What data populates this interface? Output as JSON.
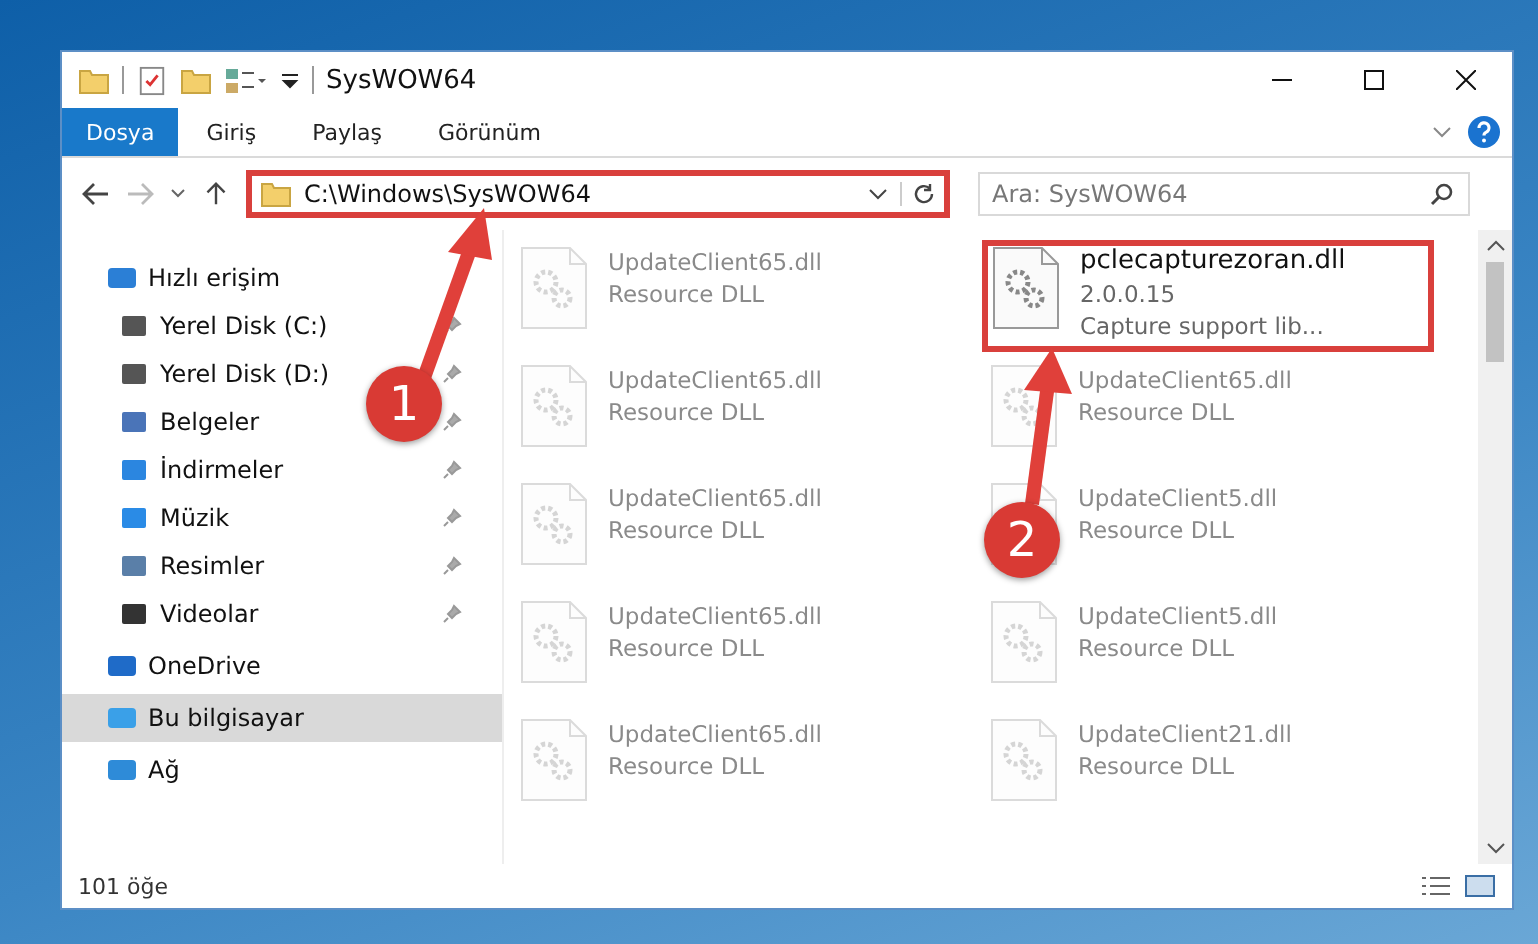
{
  "window": {
    "title": "SysWOW64"
  },
  "ribbon_tabs": [
    {
      "label": "Dosya",
      "selected": true
    },
    {
      "label": "Giriş",
      "selected": false
    },
    {
      "label": "Paylaş",
      "selected": false
    },
    {
      "label": "Görünüm",
      "selected": false
    }
  ],
  "address_bar": {
    "path": "C:\\Windows\\SysWOW64",
    "highlighted": true
  },
  "search": {
    "placeholder": "Ara: SysWOW64"
  },
  "sidebar": {
    "items": [
      {
        "label": "Hızlı erişim",
        "selected": false,
        "children": [
          {
            "label": "Yerel Disk (C:)",
            "pinned": true
          },
          {
            "label": "Yerel Disk (D:)",
            "pinned": true
          },
          {
            "label": "Belgeler",
            "pinned": true
          },
          {
            "label": "İndirmeler",
            "pinned": true
          },
          {
            "label": "Müzik",
            "pinned": true
          },
          {
            "label": "Resimler",
            "pinned": true
          },
          {
            "label": "Videolar",
            "pinned": true
          }
        ]
      },
      {
        "label": "OneDrive",
        "selected": false
      },
      {
        "label": "Bu bilgisayar",
        "selected": true
      },
      {
        "label": "Ağ",
        "selected": false
      }
    ]
  },
  "files": [
    {
      "name": "UpdateClient65.dll",
      "description": "Resource DLL",
      "blurred": true,
      "highlighted": false
    },
    {
      "name": "pclecapturezoran.dll",
      "version": "2.0.0.15",
      "description": "Capture support lib...",
      "blurred": false,
      "highlighted": true
    },
    {
      "name": "UpdateClient65.dll",
      "description": "Resource DLL",
      "blurred": true,
      "highlighted": false
    },
    {
      "name": "UpdateClient65.dll",
      "description": "Resource DLL",
      "blurred": true,
      "highlighted": false
    },
    {
      "name": "UpdateClient65.dll",
      "description": "Resource DLL",
      "blurred": true,
      "highlighted": false
    },
    {
      "name": "UpdateClient5.dll",
      "description": "Resource DLL",
      "blurred": true,
      "highlighted": false
    },
    {
      "name": "UpdateClient65.dll",
      "description": "Resource DLL",
      "blurred": true,
      "highlighted": false
    },
    {
      "name": "UpdateClient5.dll",
      "description": "Resource DLL",
      "blurred": true,
      "highlighted": false
    },
    {
      "name": "UpdateClient65.dll",
      "description": "Resource DLL",
      "blurred": true,
      "highlighted": false
    },
    {
      "name": "UpdateClient21.dll",
      "description": "Resource DLL",
      "blurred": true,
      "highlighted": false
    }
  ],
  "status_bar": {
    "count": "101 öğe"
  },
  "annotations": [
    {
      "number": "1"
    },
    {
      "number": "2"
    }
  ]
}
